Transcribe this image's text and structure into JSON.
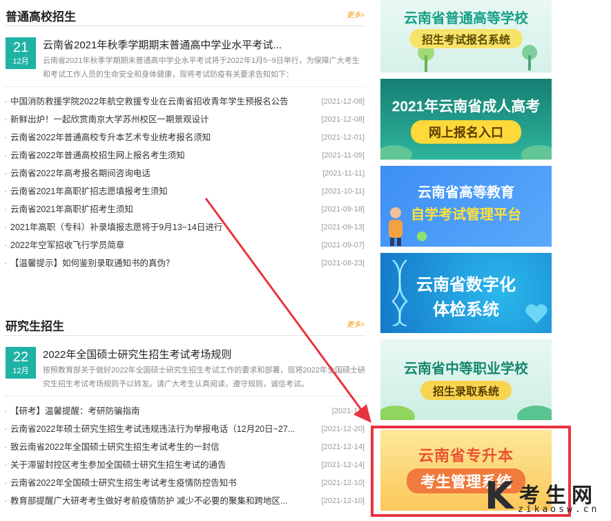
{
  "undergrad": {
    "title": "普通高校招生",
    "more": "更多>",
    "featured": {
      "day": "21",
      "month": "12月",
      "title": "云南省2021年秋季学期期末普通高中学业水平考试...",
      "desc": "云南省2021年秋季学期期末普通高中学业水平考试将于2022年1月5~9日举行，为保障广大考生和考试工作人员的生命安全和身体健康，现将考试防疫有关要求告知如下："
    },
    "items": [
      {
        "text": "中国消防救援学院2022年航空救援专业在云南省招收青年学生预报名公告",
        "date": "[2021-12-08]"
      },
      {
        "text": "新鲜出炉！一起欣赏南京大学苏州校区一期景观设计",
        "date": "[2021-12-08]"
      },
      {
        "text": "云南省2022年普通高校专升本艺术专业统考报名须知",
        "date": "[2021-12-01]"
      },
      {
        "text": "云南省2022年普通高校招生网上报名考生须知",
        "date": "[2021-11-09]"
      },
      {
        "text": "云南省2022年高考报名期间咨询电话",
        "date": "[2021-11-11]"
      },
      {
        "text": "云南省2021年高职扩招志愿填报考生须知",
        "date": "[2021-10-11]"
      },
      {
        "text": "云南省2021年高职扩招考生须知",
        "date": "[2021-09-18]"
      },
      {
        "text": "2021年高职（专科）补录填报志愿将于9月13~14日进行",
        "date": "[2021-09-13]"
      },
      {
        "text": "2022年空军招收飞行学员简章",
        "date": "[2021-09-07]"
      },
      {
        "text": "【温馨提示】如何鉴别录取通知书的真伪？",
        "date": "[2021-08-23]"
      }
    ]
  },
  "graduate": {
    "title": "研究生招生",
    "more": "更多>",
    "featured": {
      "day": "22",
      "month": "12月",
      "title": "2022年全国硕士研究生招生考试考场规则",
      "desc": "按照教育部关于做好2022年全国硕士研究生招生考试工作的要求和部署，现将2022年全国硕士研究生招生考试考场规则予以转发。请广大考生认真阅读，遵守规则，诚信考试。"
    },
    "items": [
      {
        "text": "【研考】温馨提醒：考研防骗指南",
        "date": "[2021-12-"
      },
      {
        "text": "云南省2022年硕士研究生招生考试违规违法行为举报电话（12月20日~27...",
        "date": "[2021-12-20]"
      },
      {
        "text": "致云南省2022年全国硕士研究生招生考试考生的一封信",
        "date": "[2021-12-14]"
      },
      {
        "text": "关于滞留封控区考生参加全国硕士研究生招生考试的通告",
        "date": "[2021-12-14]"
      },
      {
        "text": "云南省2022年全国硕士研究生招生考试考生疫情防控告知书",
        "date": "[2021-12-10]"
      },
      {
        "text": "教育部提醒广大研考考生做好考前疫情防护 减少不必要的聚集和跨地区...",
        "date": "[2021-12-10]"
      }
    ]
  },
  "banners": [
    {
      "line1": "云南省普通高等学校",
      "line2": "招生考试报名系统"
    },
    {
      "line1": "2021年云南省成人高考",
      "line2": "网上报名入口"
    },
    {
      "line1": "云南省高等教育",
      "line2": "自学考试管理平台"
    },
    {
      "line1": "云南省数字化",
      "line2": "体检系统"
    },
    {
      "line1": "云南省中等职业学校",
      "line2": "招生录取系统"
    },
    {
      "line1": "云南省专升本",
      "line2": "考生管理系统"
    }
  ],
  "watermark": {
    "logo": "K",
    "name": "考生网",
    "url": "zikaosw.cn"
  },
  "colors": {
    "accent_teal": "#20b3a5",
    "more_orange": "#f39c12",
    "highlight_red": "#e8333f"
  }
}
